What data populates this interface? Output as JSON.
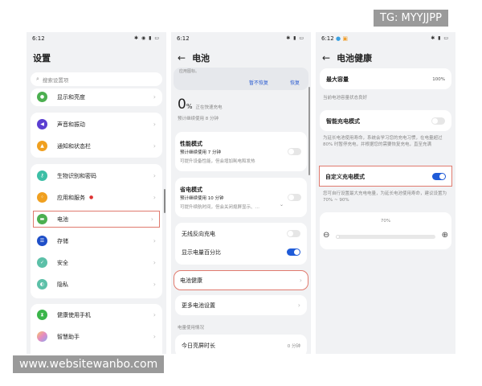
{
  "watermarks": {
    "top": "TG: MYYJJPP",
    "bottom": "www.websitewanbo.com"
  },
  "accent": "#1f5bd8",
  "settings": {
    "time": "6:12",
    "title": "设置",
    "search_placeholder": "搜索设置项",
    "items": [
      {
        "label": "显示和亮度",
        "icon": "eye-icon",
        "color": "#4caf50"
      },
      {
        "label": "声音和振动",
        "icon": "speaker-icon",
        "color": "#5b3fd1"
      },
      {
        "label": "通知和状态栏",
        "icon": "bell-icon",
        "color": "#f0a020"
      },
      {
        "label": "生物识别和密码",
        "icon": "key-icon",
        "color": "#3cbfa6"
      },
      {
        "label": "应用和服务",
        "icon": "apps-icon",
        "color": "#f0a020"
      },
      {
        "label": "电池",
        "icon": "battery-icon",
        "color": "#4caf50"
      },
      {
        "label": "存储",
        "icon": "storage-icon",
        "color": "#1f4fc8"
      },
      {
        "label": "安全",
        "icon": "shield-icon",
        "color": "#5cc0a8"
      },
      {
        "label": "隐私",
        "icon": "privacy-icon",
        "color": "#5cc0a8"
      },
      {
        "label": "健康使用手机",
        "icon": "hourglass-icon",
        "color": "#3ab54a"
      },
      {
        "label": "智慧助手",
        "icon": "assistant-icon",
        "color": "#e8a0c0"
      }
    ]
  },
  "battery": {
    "time": "6:12",
    "title": "电池",
    "notice": {
      "text": "应用图标。",
      "dismiss": "暂不恢复",
      "restore": "恢复"
    },
    "percent": "0",
    "percent_sign": "%",
    "charging": "正在快速充电",
    "remaining": "预计继续使用 8 分钟",
    "performance": {
      "title": "性能模式",
      "sub": "预计继续使用 7 分钟",
      "desc": "可提升设备性能，但会增加耗电和发热",
      "on": false
    },
    "saver": {
      "title": "省电模式",
      "sub": "预计继续使用 10 分钟",
      "desc": "可提升续航时间，但会关闭熄屏显示、…",
      "on": false
    },
    "wireless": {
      "label": "无线反向充电",
      "on": false
    },
    "show_percent": {
      "label": "显示电量百分比",
      "on": true
    },
    "health": "电池健康",
    "more": "更多电池设置",
    "usage_header": "电量使用情况",
    "screen_time": {
      "label": "今日亮屏时长",
      "value": "0 分钟"
    }
  },
  "health": {
    "time": "6:12",
    "title": "电池健康",
    "max_capacity": {
      "label": "最大容量",
      "value": "100%"
    },
    "capacity_note": "当前电池容量状态良好",
    "smart": {
      "label": "智能充电模式",
      "on": false,
      "desc": "为延长电池使用寿命，系统会学习您的充电习惯，在电量超过 80% 时暂停充电，并根据您的需要恢复充电，直至充满"
    },
    "custom": {
      "label": "自定义充电模式",
      "on": true,
      "desc": "您可自行设置最大充电电量，为延长电池使用寿命，建议设置为 70% ~ 90%"
    },
    "slider": {
      "label": "70%",
      "value": 70,
      "min": 70,
      "max": 100
    }
  }
}
